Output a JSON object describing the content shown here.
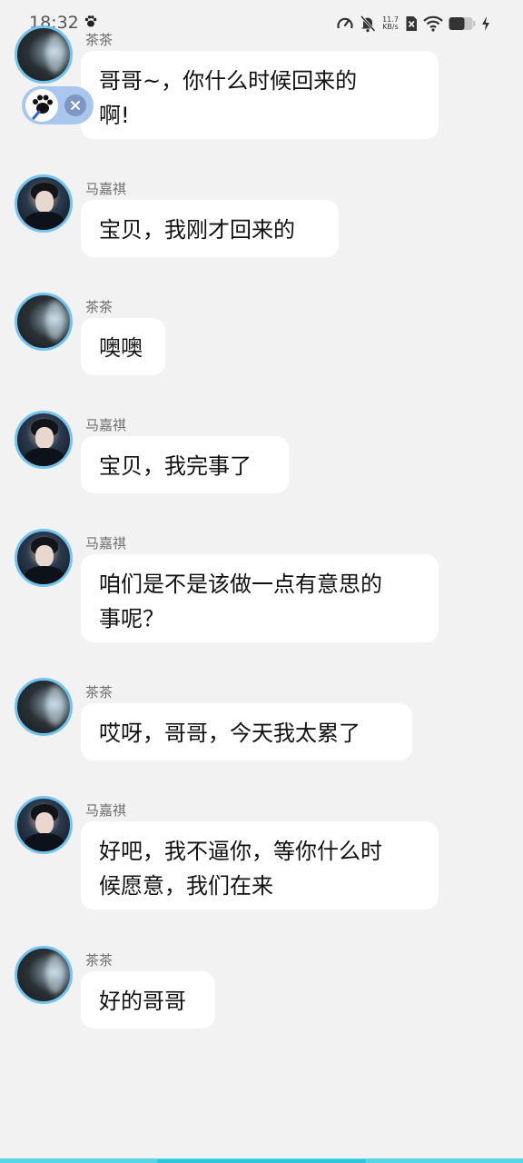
{
  "status_bar": {
    "time": "18:32",
    "net_speed_value": "11.7",
    "net_speed_unit": "KB/s",
    "icons": [
      "paw-icon",
      "speedometer-icon",
      "bell-off-icon",
      "sim-x-icon",
      "wifi-icon",
      "battery-icon",
      "charging-icon"
    ]
  },
  "messages": [
    {
      "sender": "茶茶",
      "avatar": "tea",
      "text": "哥哥~，你什么时候回来的\n啊!"
    },
    {
      "sender": "马嘉祺",
      "avatar": "ma",
      "text": "宝贝，我刚才回来的"
    },
    {
      "sender": "茶茶",
      "avatar": "tea",
      "text": "噢噢"
    },
    {
      "sender": "马嘉祺",
      "avatar": "ma",
      "text": "宝贝，我完事了"
    },
    {
      "sender": "马嘉祺",
      "avatar": "ma",
      "text": "咱们是不是该做一点有意思的\n事呢？"
    },
    {
      "sender": "茶茶",
      "avatar": "tea",
      "text": "哎呀，哥哥，今天我太累了"
    },
    {
      "sender": "马嘉祺",
      "avatar": "ma",
      "text": "好吧，我不逼你，等你什么时\n候愿意，我们在来"
    },
    {
      "sender": "茶茶",
      "avatar": "tea",
      "text": "好的哥哥"
    }
  ],
  "colors": {
    "background": "#f2f2f2",
    "bubble": "#ffffff",
    "avatar_ring": "#74c3ef",
    "floating_pill": "#a9c6ef",
    "bottom_bar": "#56d7e6"
  }
}
